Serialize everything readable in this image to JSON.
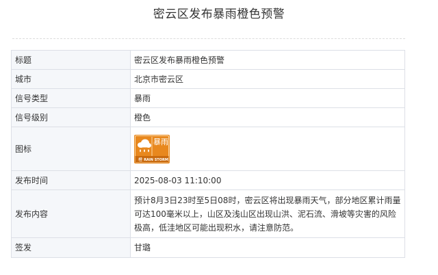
{
  "page": {
    "title": "密云区发布暴雨橙色预警"
  },
  "table": {
    "rows": [
      {
        "label": "标题",
        "value": "密云区发布暴雨橙色预警"
      },
      {
        "label": "城市",
        "value": "北京市密云区"
      },
      {
        "label": "信号类型",
        "value": "暴雨"
      },
      {
        "label": "信号级别",
        "value": "橙色"
      },
      {
        "label": "图标",
        "icon": {
          "name": "rainstorm-orange-warning-icon",
          "text_cn": "暴雨",
          "text_en": "RAIN STORM",
          "text_level": "橙",
          "color": "#e8881e"
        }
      },
      {
        "label": "发布时间",
        "value": "2025-08-03 11:10:00"
      },
      {
        "label": "发布内容",
        "value": "预计8月3日23时至5日08时，密云区将出现暴雨天气，部分地区累计雨量可达100毫米以上，山区及浅山区出现山洪、泥石流、滑坡等灾害的风险极高，低洼地区可能出现积水，请注意防范。"
      },
      {
        "label": "签发",
        "value": "甘璐"
      }
    ]
  },
  "colors": {
    "border": "#dcdfe6",
    "label_bg": "#f5f7fa",
    "warning_orange": "#e8881e"
  }
}
